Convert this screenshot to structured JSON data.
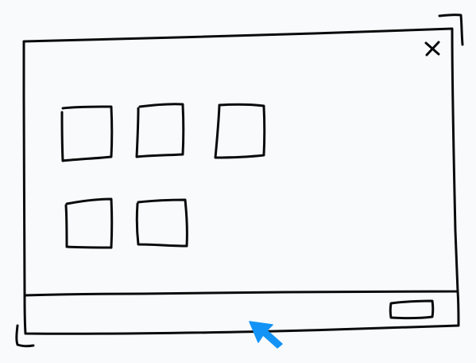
{
  "window": {
    "title": "",
    "close_icon": "close-icon"
  },
  "desktop": {
    "icons": [
      {
        "name": "app-icon-1",
        "label": ""
      },
      {
        "name": "app-icon-2",
        "label": ""
      },
      {
        "name": "app-icon-3",
        "label": ""
      },
      {
        "name": "app-icon-4",
        "label": ""
      },
      {
        "name": "app-icon-5",
        "label": ""
      }
    ]
  },
  "taskbar": {
    "button_label": ""
  },
  "cursor": {
    "icon": "pointer-cursor-icon",
    "color": "#1393f5"
  },
  "colors": {
    "background": "#f8fafc",
    "stroke": "#0a0a0a",
    "accent": "#1393f5"
  }
}
